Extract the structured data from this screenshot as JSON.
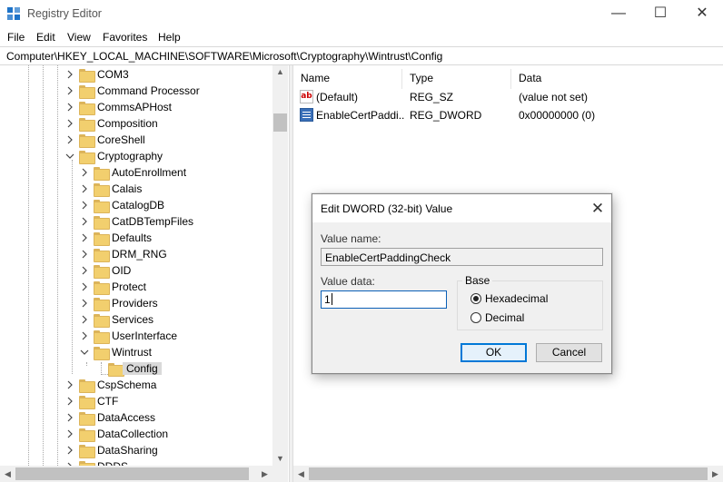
{
  "window": {
    "title": "Registry Editor",
    "minimize_glyph": "—",
    "maximize_glyph": "☐",
    "close_glyph": "✕"
  },
  "menu": [
    "File",
    "Edit",
    "View",
    "Favorites",
    "Help"
  ],
  "address": "Computer\\HKEY_LOCAL_MACHINE\\SOFTWARE\\Microsoft\\Cryptography\\Wintrust\\Config",
  "tree": {
    "items": [
      {
        "label": "COM3",
        "expanded": false,
        "selected": false
      },
      {
        "label": "Command Processor",
        "expanded": false,
        "selected": false
      },
      {
        "label": "CommsAPHost",
        "expanded": false,
        "selected": false
      },
      {
        "label": "Composition",
        "expanded": false,
        "selected": false
      },
      {
        "label": "CoreShell",
        "expanded": false,
        "selected": false
      },
      {
        "label": "Cryptography",
        "expanded": true,
        "selected": false
      },
      {
        "label": "AutoEnrollment",
        "expanded": false,
        "selected": false
      },
      {
        "label": "Calais",
        "expanded": false,
        "selected": false
      },
      {
        "label": "CatalogDB",
        "expanded": false,
        "selected": false
      },
      {
        "label": "CatDBTempFiles",
        "expanded": false,
        "selected": false
      },
      {
        "label": "Defaults",
        "expanded": false,
        "selected": false
      },
      {
        "label": "DRM_RNG",
        "expanded": false,
        "selected": false
      },
      {
        "label": "OID",
        "expanded": false,
        "selected": false
      },
      {
        "label": "Protect",
        "expanded": false,
        "selected": false
      },
      {
        "label": "Providers",
        "expanded": false,
        "selected": false
      },
      {
        "label": "Services",
        "expanded": false,
        "selected": false
      },
      {
        "label": "UserInterface",
        "expanded": false,
        "selected": false
      },
      {
        "label": "Wintrust",
        "expanded": true,
        "selected": false
      },
      {
        "label": "Config",
        "expanded": false,
        "selected": true
      },
      {
        "label": "CspSchema",
        "expanded": false,
        "selected": false
      },
      {
        "label": "CTF",
        "expanded": false,
        "selected": false
      },
      {
        "label": "DataAccess",
        "expanded": false,
        "selected": false
      },
      {
        "label": "DataCollection",
        "expanded": false,
        "selected": false
      },
      {
        "label": "DataSharing",
        "expanded": false,
        "selected": false
      },
      {
        "label": "DDDS",
        "expanded": false,
        "selected": false
      }
    ]
  },
  "list": {
    "columns": [
      "Name",
      "Type",
      "Data"
    ],
    "rows": [
      {
        "name": "(Default)",
        "type": "REG_SZ",
        "data": "(value not set)",
        "icon": "string-value-icon"
      },
      {
        "name": "EnableCertPaddi...",
        "type": "REG_DWORD",
        "data": "0x00000000 (0)",
        "icon": "dword-value-icon"
      }
    ]
  },
  "dialog": {
    "title": "Edit DWORD (32-bit) Value",
    "value_name_label": "Value name:",
    "value_name": "EnableCertPaddingCheck",
    "value_data_label": "Value data:",
    "value_data": "1",
    "base_label": "Base",
    "base_options": [
      {
        "label": "Hexadecimal",
        "selected": true
      },
      {
        "label": "Decimal",
        "selected": false
      }
    ],
    "ok_label": "OK",
    "cancel_label": "Cancel"
  },
  "colors": {
    "accent": "#0078d7",
    "folder": "#f2cf6e",
    "selection": "#d9d9d9"
  }
}
